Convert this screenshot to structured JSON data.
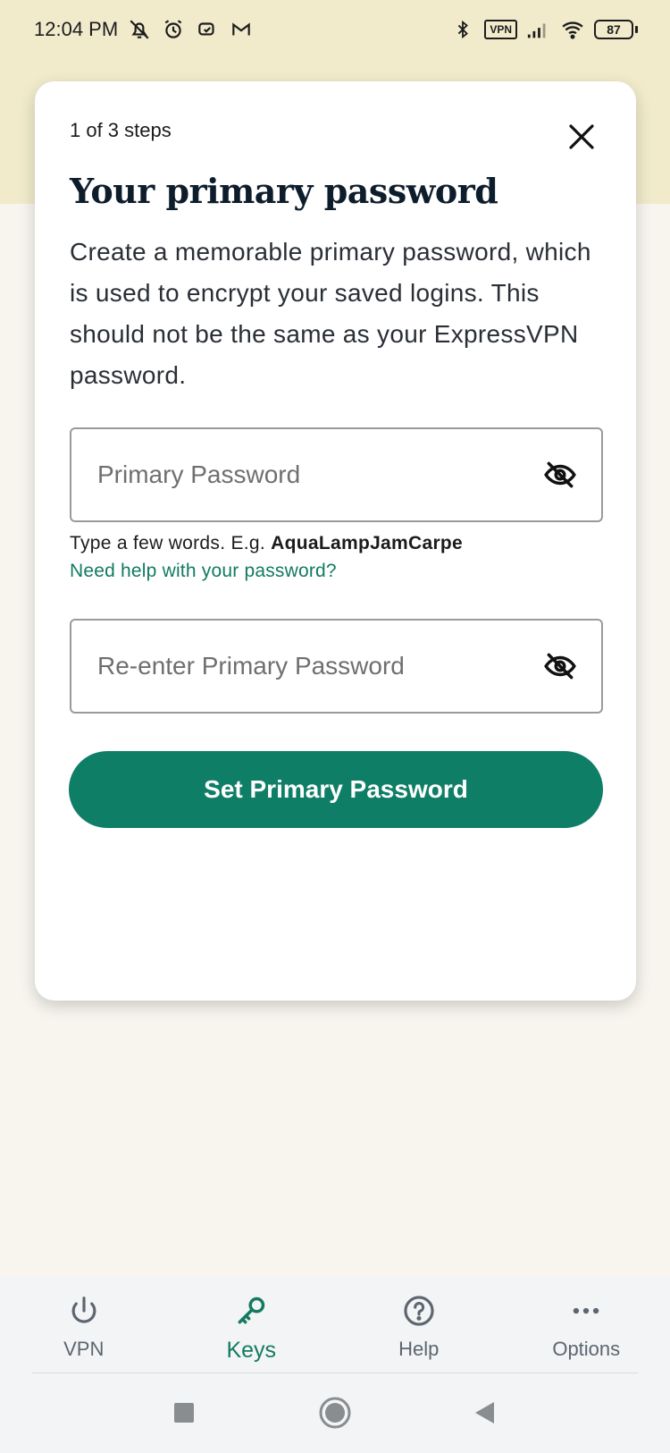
{
  "status_bar": {
    "time": "12:04 PM",
    "vpn_badge": "VPN",
    "battery": "87",
    "left_icons": [
      "muted-bell-icon",
      "alarm-icon",
      "app-notification-icon",
      "gmail-icon"
    ],
    "right_icons": [
      "bluetooth-icon",
      "vpn-icon",
      "signal-icon",
      "wifi-icon",
      "battery-icon"
    ]
  },
  "dialog": {
    "step_label": "1 of 3 steps",
    "title": "Your primary password",
    "description": "Create a memorable primary password, which is used to encrypt your saved logins. This should not be the same as your ExpressVPN password.",
    "password_field": {
      "placeholder": "Primary Password",
      "value": ""
    },
    "hint_prefix": "Type a few words. E.g. ",
    "hint_example": "AquaLampJamCarpe",
    "help_link": "Need help with your password?",
    "confirm_field": {
      "placeholder": "Re-enter Primary Password",
      "value": ""
    },
    "submit_label": "Set Primary Password"
  },
  "tabs": [
    {
      "label": "VPN",
      "icon": "power-icon",
      "active": false
    },
    {
      "label": "Keys",
      "icon": "key-icon",
      "active": true
    },
    {
      "label": "Help",
      "icon": "question-circle-icon",
      "active": false
    },
    {
      "label": "Options",
      "icon": "more-dots-icon",
      "active": false
    }
  ],
  "colors": {
    "accent": "#0f7e66",
    "top_band": "#f1ebcc",
    "background": "#f7f5ee",
    "title": "#0e1d2c"
  }
}
